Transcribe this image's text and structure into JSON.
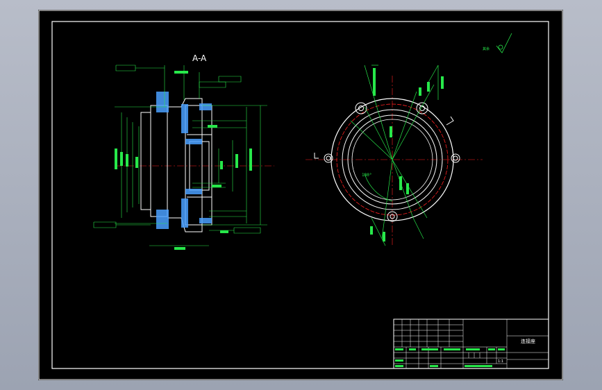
{
  "drawing": {
    "section_label": "A-A",
    "roughness_note": "其余",
    "angle_label": "180°",
    "title_block": {
      "part_name": "连接座",
      "scale": "1:1",
      "cells": [
        "标记",
        "处数",
        "分区",
        "更改文件号",
        "签名",
        "年月日",
        "设计",
        "标准化",
        "审核",
        "工艺",
        "批准",
        "阶段标记",
        "重量",
        "比例",
        "共",
        "张",
        "第",
        "张"
      ]
    }
  },
  "colors": {
    "background": "#000000",
    "frame": "#ffffff",
    "dimension": "#27e84a",
    "centerline": "#ff2020",
    "hatch": "#4aa0ff",
    "part": "#ffffff"
  }
}
